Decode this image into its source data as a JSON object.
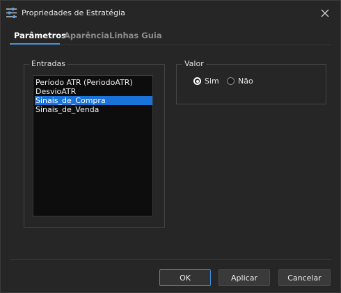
{
  "window": {
    "title": "Propriedades de Estratégia",
    "icon": "sliders-icon",
    "close_icon": "close-icon"
  },
  "tabs": [
    {
      "label": "Parâmetros",
      "active": true
    },
    {
      "label": "Aparência",
      "active": false
    },
    {
      "label": "Linhas Guia",
      "active": false
    }
  ],
  "inputs_group": {
    "label": "Entradas",
    "items": [
      {
        "label": "Período ATR (PeriodoATR)",
        "selected": false
      },
      {
        "label": "DesvioATR",
        "selected": false
      },
      {
        "label": "Sinais_de_Compra",
        "selected": true
      },
      {
        "label": "Sinais_de_Venda",
        "selected": false
      }
    ]
  },
  "value_group": {
    "label": "Valor",
    "options": [
      {
        "label": "Sim",
        "checked": true
      },
      {
        "label": "Não",
        "checked": false
      }
    ]
  },
  "buttons": {
    "ok": "OK",
    "apply": "Aplicar",
    "cancel": "Cancelar"
  },
  "colors": {
    "accent": "#3b8fe0",
    "selection": "#1a73d9",
    "background": "#262626"
  }
}
